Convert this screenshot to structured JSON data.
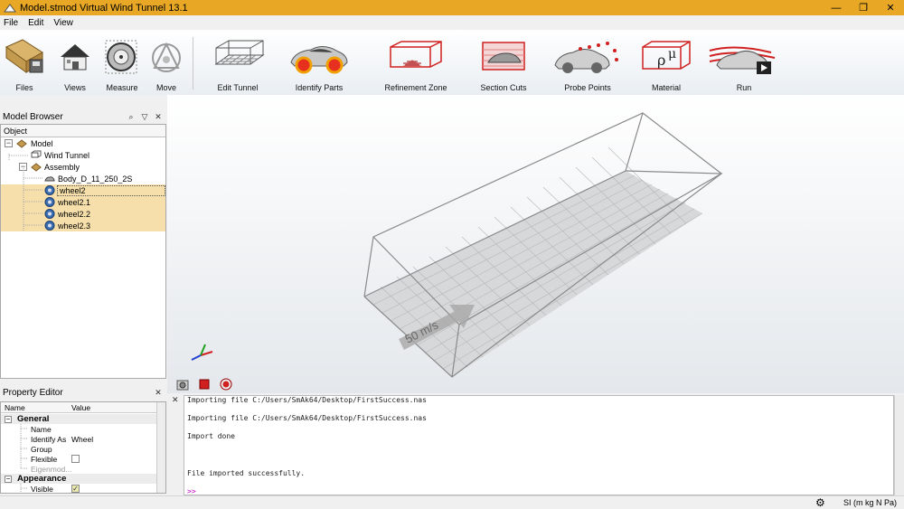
{
  "window": {
    "title": "Model.stmod Virtual Wind Tunnel 13.1",
    "controls": [
      "—",
      "❐",
      "✕"
    ]
  },
  "menu": [
    "File",
    "Edit",
    "View"
  ],
  "toolbar": {
    "files": "Files",
    "views": "Views",
    "measure": "Measure",
    "move": "Move",
    "edit_tunnel": "Edit Tunnel",
    "identify_parts": "Identify Parts",
    "refinement_zone": "Refinement Zone",
    "section_cuts": "Section Cuts",
    "probe_points": "Probe Points",
    "material": "Material",
    "run": "Run"
  },
  "model_browser": {
    "title": "Model Browser",
    "column": "Object",
    "items": [
      {
        "label": "Model"
      },
      {
        "label": "Wind Tunnel"
      },
      {
        "label": "Assembly"
      },
      {
        "label": "Body_D_11_250_2S"
      },
      {
        "label": "wheel2"
      },
      {
        "label": "wheel2.1"
      },
      {
        "label": "wheel2.2"
      },
      {
        "label": "wheel2.3"
      }
    ]
  },
  "property_editor": {
    "title": "Property Editor",
    "col_name": "Name",
    "col_value": "Value",
    "general": "General",
    "name": "Name",
    "identify_as": "Identify As",
    "identify_value": "Wheel",
    "group": "Group",
    "flexible": "Flexible",
    "eigenmod": "Eigenmod...",
    "appearance": "Appearance",
    "visible": "Visible"
  },
  "viewport": {
    "speed_label": "50 m/s"
  },
  "console": {
    "lines": [
      "Importing file C:/Users/SmAk64/Desktop/FirstSuccess.nas",
      "Importing file C:/Users/SmAk64/Desktop/FirstSuccess.nas",
      "Import done",
      "File imported successfully."
    ],
    "prompt": ">>"
  },
  "statusbar": {
    "units": "SI (m kg N Pa)"
  },
  "colors": {
    "titlebar": "#e8a825",
    "selection": "#f6dfaa",
    "accent_red": "#d02020"
  }
}
